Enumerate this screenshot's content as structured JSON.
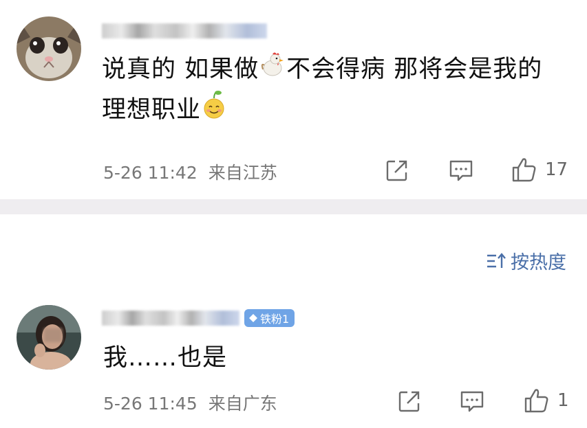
{
  "comments": [
    {
      "text_line1_a": "说真的 如果做",
      "text_line1_b": "不会得病 那将会是我的",
      "text_line2": "理想职业",
      "time": "5-26 11:42",
      "location": "来自江苏",
      "likes": "17",
      "icons": [
        "share-icon",
        "comment-icon",
        "like-icon"
      ]
    },
    {
      "text": "我……也是",
      "badge": "铁粉1",
      "time": "5-26 11:45",
      "location": "来自广东",
      "likes": "1",
      "icons": [
        "share-icon",
        "comment-icon",
        "like-icon"
      ]
    }
  ],
  "sort": {
    "label": "按热度"
  },
  "colors": {
    "accent": "#4a6fa8",
    "badge": "#6fa4e6",
    "meta": "#777777"
  }
}
